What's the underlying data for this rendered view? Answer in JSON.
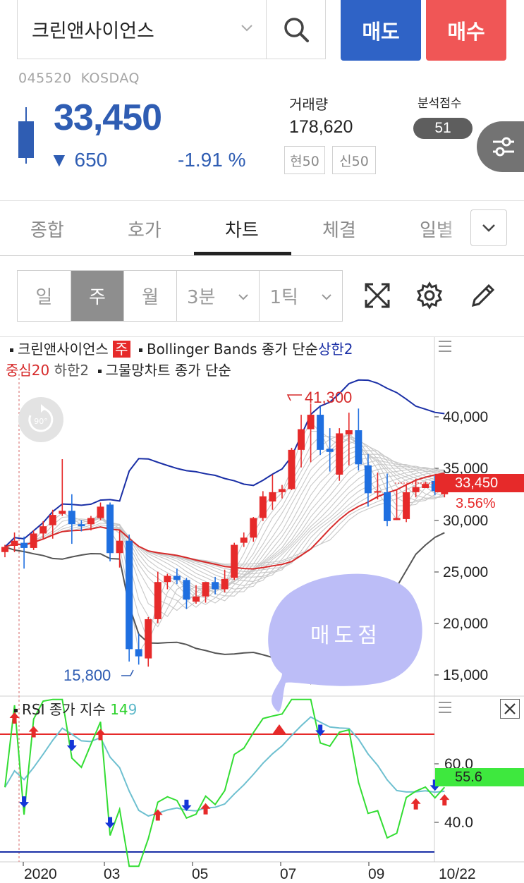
{
  "header": {
    "stock_name": "크린앤사이언스",
    "sell_label": "매도",
    "buy_label": "매수",
    "code": "045520",
    "market": "KOSDAQ",
    "price": "33,450",
    "change": "▼ 650",
    "change_pct": "-1.91 %",
    "volume_label": "거래량",
    "volume": "178,620",
    "tag_hyun": "현50",
    "tag_sin": "신50",
    "score_label": "분석점수",
    "score": "51"
  },
  "tabs": [
    "종합",
    "호가",
    "차트",
    "체결",
    "일별"
  ],
  "active_tab": "차트",
  "periods": [
    "일",
    "주",
    "월",
    "3분",
    "1틱"
  ],
  "active_period": "주",
  "legend": {
    "stock": "크린앤사이언스",
    "period_badge": "주",
    "bollinger": "Bollinger Bands",
    "bollinger_src": "종가",
    "bollinger_type": "단순",
    "upper": "상한2",
    "middle": "중심20",
    "lower": "하한2",
    "rainbow": "그물망차트",
    "rainbow_src": "종가",
    "rainbow_type": "단순"
  },
  "rotate_label": "90°",
  "price_axis": [
    "40,000",
    "35,000",
    "30,000",
    "25,000",
    "20,000",
    "15,000"
  ],
  "current_price_tag": "33,450",
  "current_pct": "3.56%",
  "high_marker": "41,300",
  "low_marker": "15,800",
  "annotation": "매도점",
  "rsi": {
    "name": "RSI",
    "src": "종가",
    "type": "지수",
    "period": "14",
    "signal": "9",
    "axis": [
      "60.0",
      "40.0"
    ],
    "value_tag": "55.6"
  },
  "dates": [
    "2020",
    "03",
    "05",
    "07",
    "09",
    "10/22"
  ],
  "colors": {
    "up": "#e62a2a",
    "down": "#1f6fe0",
    "upper_band": "#1a2fa6",
    "middle_band": "#d62a2a",
    "lower_band": "#555555",
    "rsi_line": "#33dd33",
    "rsi_signal": "#6ec0d0",
    "bubble": "#bcbdf7"
  },
  "chart_data": {
    "type": "candlestick",
    "x": [
      "2019-12-06",
      "2019-12-13",
      "2019-12-20",
      "2019-12-27",
      "2020-01-03",
      "2020-01-10",
      "2020-01-17",
      "2020-01-24",
      "2020-01-31",
      "2020-02-07",
      "2020-02-14",
      "2020-02-21",
      "2020-02-28",
      "2020-03-06",
      "2020-03-13",
      "2020-03-20",
      "2020-03-27",
      "2020-04-03",
      "2020-04-10",
      "2020-04-17",
      "2020-04-24",
      "2020-05-01",
      "2020-05-08",
      "2020-05-15",
      "2020-05-22",
      "2020-05-29",
      "2020-06-05",
      "2020-06-12",
      "2020-06-19",
      "2020-06-26",
      "2020-07-03",
      "2020-07-10",
      "2020-07-17",
      "2020-07-24",
      "2020-07-31",
      "2020-08-07",
      "2020-08-14",
      "2020-08-21",
      "2020-08-28",
      "2020-09-04",
      "2020-09-11",
      "2020-09-18",
      "2020-09-25",
      "2020-10-02",
      "2020-10-09",
      "2020-10-16",
      "2020-10-22"
    ],
    "candles": [
      [
        26900,
        27600,
        26400,
        27400
      ],
      [
        27500,
        28800,
        26900,
        28000
      ],
      [
        27800,
        28400,
        25300,
        27300
      ],
      [
        27300,
        29000,
        27100,
        28700
      ],
      [
        28700,
        29900,
        28200,
        29400
      ],
      [
        29500,
        31000,
        28200,
        30500
      ],
      [
        30600,
        35900,
        30400,
        30900
      ],
      [
        30900,
        32500,
        27700,
        29600
      ],
      [
        29600,
        30000,
        28900,
        29400
      ],
      [
        29600,
        30400,
        29000,
        30200
      ],
      [
        30200,
        31700,
        30000,
        31300
      ],
      [
        31500,
        31700,
        26000,
        26800
      ],
      [
        26800,
        29000,
        25400,
        28000
      ],
      [
        28000,
        28600,
        16300,
        17500
      ],
      [
        17500,
        19000,
        16000,
        16800
      ],
      [
        16600,
        20600,
        15800,
        20400
      ],
      [
        20400,
        25000,
        20000,
        24000
      ],
      [
        24000,
        24800,
        23300,
        24600
      ],
      [
        24600,
        25300,
        23800,
        24200
      ],
      [
        24200,
        24400,
        21400,
        22300
      ],
      [
        22100,
        23700,
        21900,
        22600
      ],
      [
        22600,
        24000,
        22000,
        24000
      ],
      [
        24000,
        24500,
        22800,
        23300
      ],
      [
        23300,
        25200,
        23000,
        24300
      ],
      [
        24400,
        27800,
        24200,
        27600
      ],
      [
        27800,
        28800,
        27400,
        28300
      ],
      [
        28300,
        30300,
        27900,
        30200
      ],
      [
        30200,
        32800,
        29900,
        32300
      ],
      [
        31800,
        34400,
        31000,
        32700
      ],
      [
        32700,
        33400,
        32100,
        33000
      ],
      [
        33000,
        37000,
        32900,
        36800
      ],
      [
        36800,
        40200,
        35100,
        38800
      ],
      [
        38800,
        41300,
        35600,
        40200
      ],
      [
        40200,
        41000,
        36300,
        36800
      ],
      [
        36900,
        38900,
        34700,
        36600
      ],
      [
        34400,
        38900,
        33800,
        38400
      ],
      [
        38300,
        40400,
        35300,
        38700
      ],
      [
        38700,
        40800,
        34800,
        35400
      ],
      [
        35300,
        36400,
        31300,
        32600
      ],
      [
        32700,
        34600,
        32000,
        32800
      ],
      [
        32700,
        34500,
        29400,
        29900
      ],
      [
        30000,
        33000,
        30000,
        30200
      ],
      [
        30100,
        33500,
        29800,
        32700
      ],
      [
        32700,
        34000,
        32200,
        33200
      ],
      [
        33100,
        33700,
        33200,
        33500
      ],
      [
        33800,
        34300,
        32400,
        32800
      ],
      [
        32500,
        34500,
        32200,
        33450
      ]
    ]
  }
}
